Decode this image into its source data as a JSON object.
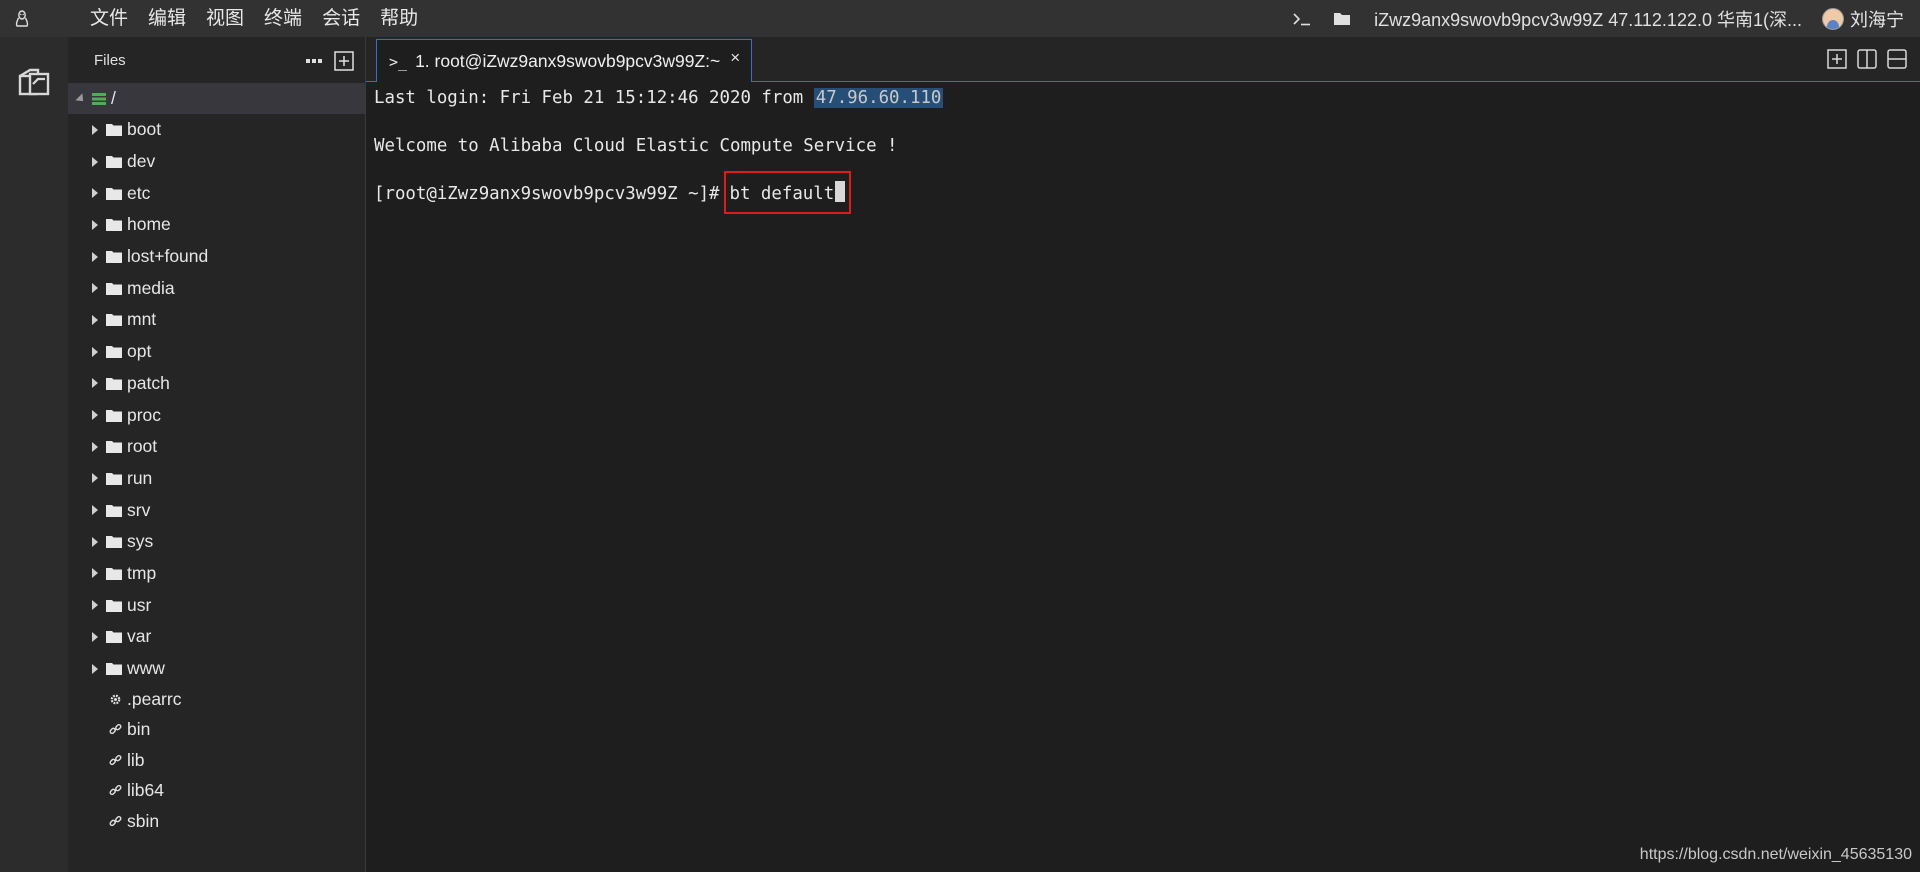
{
  "menubar": {
    "items": [
      "文件",
      "编辑",
      "视图",
      "终端",
      "会话",
      "帮助"
    ],
    "server_info": "iZwz9anx9swovb9pcv3w99Z 47.112.122.0 华南1(深...",
    "user_name": "刘海宁"
  },
  "sidebar": {
    "title": "Files",
    "root_label": "/",
    "directories": [
      "boot",
      "dev",
      "etc",
      "home",
      "lost+found",
      "media",
      "mnt",
      "opt",
      "patch",
      "proc",
      "root",
      "run",
      "srv",
      "sys",
      "tmp",
      "usr",
      "var",
      "www"
    ],
    "files": [
      {
        "label": ".pearrc",
        "icon": "gear-icon"
      },
      {
        "label": "bin",
        "icon": "link-icon"
      },
      {
        "label": "lib",
        "icon": "link-icon"
      },
      {
        "label": "lib64",
        "icon": "link-icon"
      },
      {
        "label": "sbin",
        "icon": "link-icon"
      }
    ]
  },
  "tab": {
    "label": "1. root@iZwz9anx9swovb9pcv3w99Z:~",
    "close": "×"
  },
  "terminal": {
    "login_prefix": "Last login: Fri Feb 21 15:12:46 2020 from ",
    "login_ip": "47.96.60.110",
    "welcome": "Welcome to Alibaba Cloud Elastic Compute Service !",
    "prompt": "[root@iZwz9anx9swovb9pcv3w99Z ~]#",
    "command": "bt default"
  },
  "watermark": "https://blog.csdn.net/weixin_45635130",
  "colors": {
    "accent": "#2f6fd6",
    "highlight_box": "#e3191a",
    "folder": "#e8e8e8",
    "root_icon": "#4caf50"
  }
}
